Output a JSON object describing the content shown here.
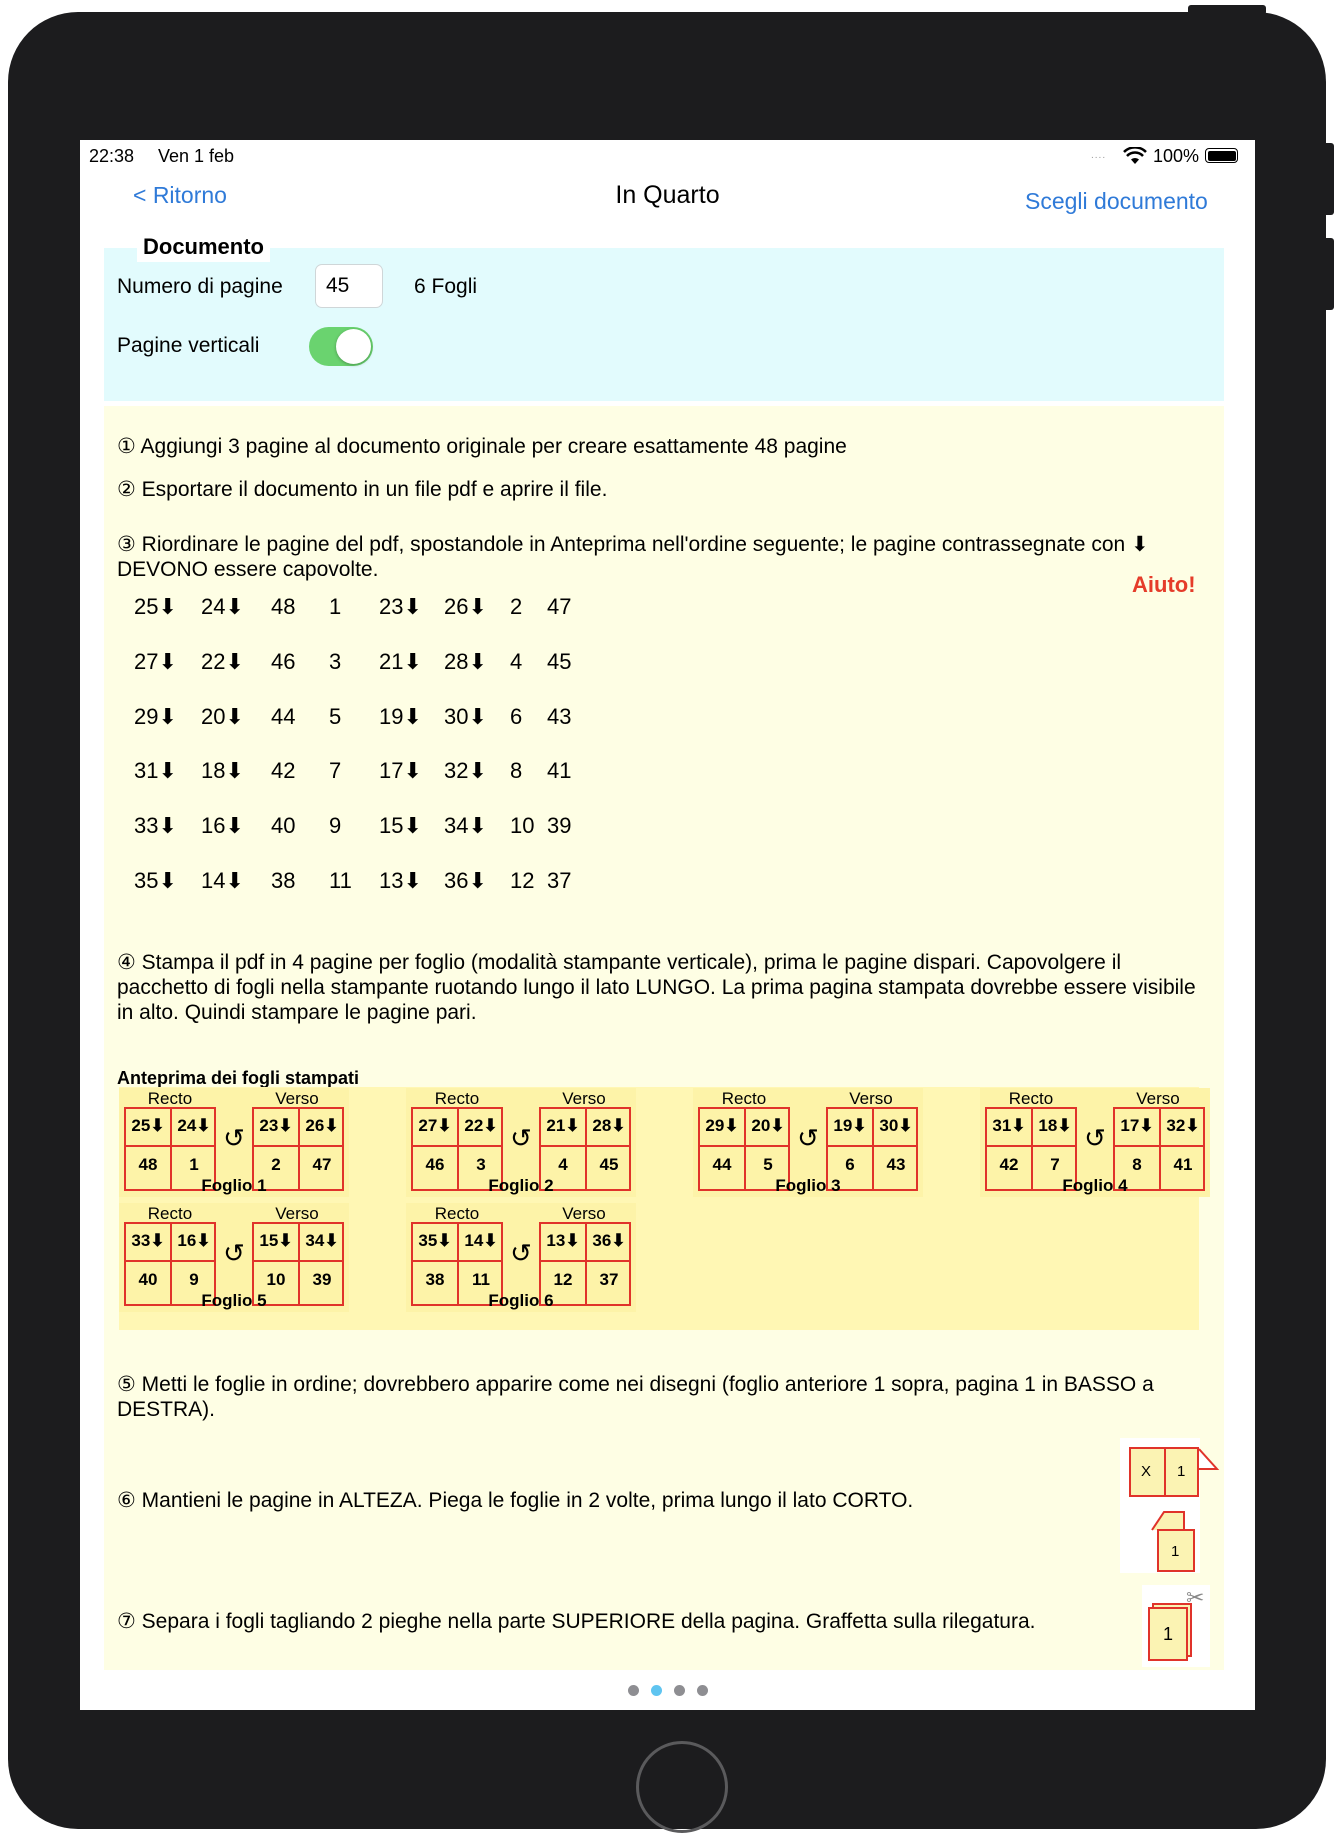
{
  "status": {
    "time": "22:38",
    "date": "Ven 1 feb",
    "battery": "100%"
  },
  "nav": {
    "back": "< Ritorno",
    "title": "In Quarto",
    "choose": "Scegli documento"
  },
  "document": {
    "heading": "Documento",
    "pages_label": "Numero di pagine",
    "pages_value": "45",
    "sheets": "6 Fogli",
    "vertical_label": "Pagine verticali",
    "vertical_on": true
  },
  "steps": {
    "s1": "① Aggiungi 3 pagine al documento originale per creare esattamente 48 pagine",
    "s2": "② Esportare il documento in un file pdf e aprire il file.",
    "s3": "③ Riordinare le pagine del pdf, spostandole in Anteprima nell'ordine seguente; le pagine contrassegnate con ⬇︎ DEVONO essere capovolte.",
    "help": "Aiuto!",
    "s4": "④ Stampa il pdf in 4 pagine per foglio (modalità stampante verticale), prima le pagine dispari. Capovolgere il pacchetto di fogli nella stampante ruotando lungo il lato LUNGO. La prima pagina stampata dovrebbe essere visibile in alto. Quindi stampare le pagine pari.",
    "preview_title": "Anteprima dei fogli stampati",
    "s5": "⑤ Metti le foglie in ordine; dovrebbero apparire come nei disegni (foglio anteriore 1 sopra, pagina 1 in BASSO a DESTRA).",
    "s6": "⑥ Mantieni le pagine in ALTEZA. Piega le foglie in 2 volte, prima lungo il lato CORTO.",
    "s7": "⑦ Separa i fogli tagliando 2 pieghe nella parte SUPERIORE della pagina. Graffetta sulla rilegatura."
  },
  "order_rows": [
    [
      "25⬇︎",
      "24⬇︎",
      "48",
      "1",
      "23⬇︎",
      "26⬇︎",
      "2",
      "47"
    ],
    [
      "27⬇︎",
      "22⬇︎",
      "46",
      "3",
      "21⬇︎",
      "28⬇︎",
      "4",
      "45"
    ],
    [
      "29⬇︎",
      "20⬇︎",
      "44",
      "5",
      "19⬇︎",
      "30⬇︎",
      "6",
      "43"
    ],
    [
      "31⬇︎",
      "18⬇︎",
      "42",
      "7",
      "17⬇︎",
      "32⬇︎",
      "8",
      "41"
    ],
    [
      "33⬇︎",
      "16⬇︎",
      "40",
      "9",
      "15⬇︎",
      "34⬇︎",
      "10",
      "39"
    ],
    [
      "35⬇︎",
      "14⬇︎",
      "38",
      "11",
      "13⬇︎",
      "36⬇︎",
      "12",
      "37"
    ]
  ],
  "sheet_labels": {
    "recto": "Recto",
    "verso": "Verso",
    "rotate_icon": "↺"
  },
  "sheets": [
    {
      "name": "Foglio 1",
      "recto": [
        "25⬇︎",
        "24⬇︎",
        "48",
        "1"
      ],
      "verso": [
        "23⬇︎",
        "26⬇︎",
        "2",
        "47"
      ]
    },
    {
      "name": "Foglio 2",
      "recto": [
        "27⬇︎",
        "22⬇︎",
        "46",
        "3"
      ],
      "verso": [
        "21⬇︎",
        "28⬇︎",
        "4",
        "45"
      ]
    },
    {
      "name": "Foglio 3",
      "recto": [
        "29⬇︎",
        "20⬇︎",
        "44",
        "5"
      ],
      "verso": [
        "19⬇︎",
        "30⬇︎",
        "6",
        "43"
      ]
    },
    {
      "name": "Foglio 4",
      "recto": [
        "31⬇︎",
        "18⬇︎",
        "42",
        "7"
      ],
      "verso": [
        "17⬇︎",
        "32⬇︎",
        "8",
        "41"
      ]
    },
    {
      "name": "Foglio 5",
      "recto": [
        "33⬇︎",
        "16⬇︎",
        "40",
        "9"
      ],
      "verso": [
        "15⬇︎",
        "34⬇︎",
        "10",
        "39"
      ]
    },
    {
      "name": "Foglio 6",
      "recto": [
        "35⬇︎",
        "14⬇︎",
        "38",
        "11"
      ],
      "verso": [
        "13⬇︎",
        "36⬇︎",
        "12",
        "37"
      ]
    }
  ],
  "fold_icon": {
    "left": "X",
    "right": "1",
    "single": "1"
  },
  "cut_icon": {
    "page": "1",
    "scissors": "✂"
  },
  "page_indicator": {
    "count": 4,
    "current": 2
  },
  "colors": {
    "accent": "#2f7ad8",
    "help": "#e53c2a",
    "toggle_on": "#6ad36f",
    "doc_panel": "#e2fbfd",
    "main_panel": "#fefee4",
    "sheet_border": "#e0332a"
  }
}
